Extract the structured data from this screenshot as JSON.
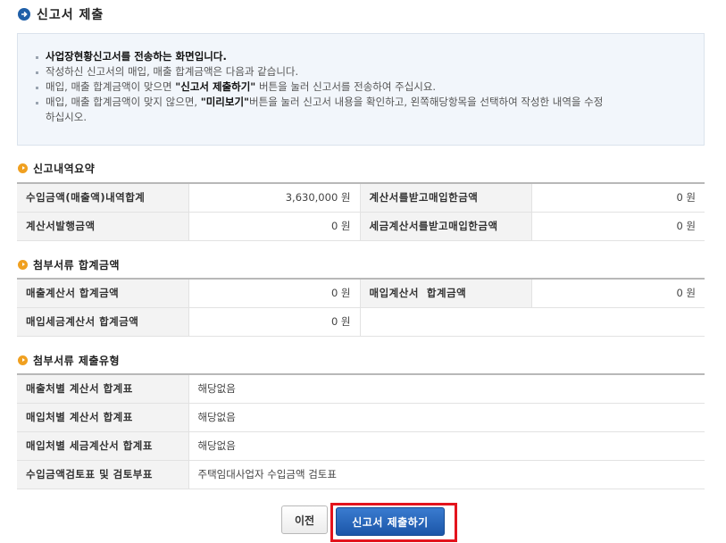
{
  "page": {
    "title": "신고서 제출"
  },
  "info": {
    "line1": "사업장현황신고서를 전송하는 화면입니다.",
    "line2": "작성하신 신고서의 매입, 매출 합계금액은 다음과 같습니다.",
    "line3_pre": "매입, 매출 합계금액이 맞으면 ",
    "line3_bold": "\"신고서 제출하기\"",
    "line3_post": " 버튼을 눌러 신고서를 전송하여 주십시요.",
    "line4_pre": "매입, 매출 합계금액이 맞지 않으면, ",
    "line4_bold": "\"미리보기\"",
    "line4_post": "버튼을 눌러 신고서 내용을 확인하고, 왼쪽해당항목을 선택하여 작성한 내역을 수정",
    "line5": "하십시오."
  },
  "summary": {
    "title": "신고내역요약",
    "rows": [
      {
        "label1": "수입금액(매출액)내역합계",
        "value1": "3,630,000 원",
        "label2": "계산서를받고매입한금액",
        "value2": "0 원"
      },
      {
        "label1": "계산서발행금액",
        "value1": "0 원",
        "label2": "세금계산서를받고매입한금액",
        "value2": "0 원"
      }
    ]
  },
  "attach_total": {
    "title": "첨부서류 합계금액",
    "rows": [
      {
        "label1": "매출계산서 합계금액",
        "value1": "0 원",
        "label2": "매입계산서  합계금액",
        "value2": "0 원"
      },
      {
        "label1": "매입세금계산서 합계금액",
        "value1": "0 원"
      }
    ]
  },
  "attach_type": {
    "title": "첨부서류 제출유형",
    "rows": [
      {
        "label": "매출처별 계산서 합계표",
        "value": "해당없음"
      },
      {
        "label": "매입처별 계산서 합계표",
        "value": "해당없음"
      },
      {
        "label": "매입처별 세금계산서 합계표",
        "value": "해당없음"
      },
      {
        "label": "수입금액검토표 및 검토부표",
        "value": "주택임대사업자 수입금액 검토표"
      }
    ]
  },
  "buttons": {
    "prev": "이전",
    "submit": "신고서 제출하기"
  },
  "colors": {
    "accent": "#1f5fa8",
    "highlight": "#e3141d",
    "section_icon": "#f0a020"
  }
}
